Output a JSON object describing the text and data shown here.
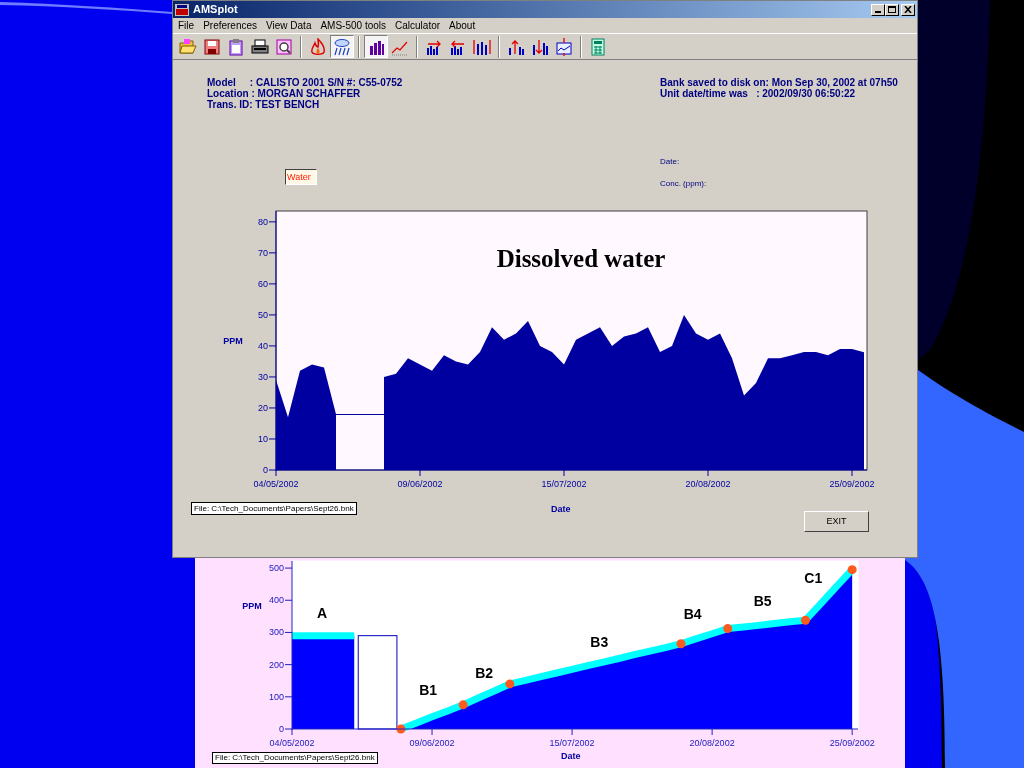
{
  "window": {
    "title": "AMSplot"
  },
  "menu": [
    "File",
    "Preferences",
    "View Data",
    "AMS-500 tools",
    "Calculator",
    "About"
  ],
  "toolbar": [
    [
      {
        "kind": "folder",
        "selected": false
      },
      {
        "kind": "floppy",
        "selected": false
      },
      {
        "kind": "clipboard",
        "selected": false
      },
      {
        "kind": "printer",
        "selected": false
      },
      {
        "kind": "preview",
        "selected": false
      }
    ],
    [
      {
        "kind": "flame",
        "selected": false
      },
      {
        "kind": "rain",
        "selected": true
      }
    ],
    [
      {
        "kind": "bars",
        "selected": true
      },
      {
        "kind": "line",
        "selected": false
      }
    ],
    [
      {
        "kind": "bars-right",
        "selected": false
      },
      {
        "kind": "bars-left",
        "selected": false
      },
      {
        "kind": "bars-expand",
        "selected": false
      }
    ],
    [
      {
        "kind": "bars-up",
        "selected": false
      },
      {
        "kind": "bars-down",
        "selected": false
      },
      {
        "kind": "bars-zoom",
        "selected": false
      }
    ],
    [
      {
        "kind": "calculator",
        "selected": false
      }
    ]
  ],
  "info": {
    "lines": [
      "Model     : CALISTO 2001 S/N #: C55-0752",
      "Location : MORGAN SCHAFFER",
      "Trans. ID: TEST BENCH"
    ],
    "saved": [
      "Bank saved to disk on: Mon Sep 30, 2002 at 07h50",
      "Unit date/time was   : 2002/09/30 06:50:22"
    ]
  },
  "gas_field": {
    "value": "Water"
  },
  "cursor_readout": [
    "Date:",
    "Conc. (ppm):"
  ],
  "chart": {
    "chart_data": {
      "type": "area",
      "title": "Dissolved water",
      "xlabel": "Date",
      "ylabel": "PPM",
      "categories": [
        "04/05/2002",
        null,
        null,
        null,
        null,
        null,
        null,
        null,
        null,
        null,
        null,
        null,
        "09/06/2002",
        null,
        null,
        null,
        null,
        null,
        null,
        null,
        null,
        null,
        null,
        null,
        "15/07/2002",
        null,
        null,
        null,
        null,
        null,
        null,
        null,
        null,
        null,
        null,
        null,
        "20/08/2002",
        null,
        null,
        null,
        null,
        null,
        null,
        null,
        null,
        null,
        null,
        null,
        "25/09/2002",
        null
      ],
      "series": [
        {
          "color": "#0000a0",
          "values": [
            29,
            17,
            32,
            34,
            33,
            18,
            null,
            null,
            null,
            30,
            31,
            36,
            34,
            32,
            37,
            35,
            34,
            38,
            46,
            42,
            44,
            48,
            40,
            38,
            34,
            42,
            44,
            46,
            40,
            43,
            44,
            46,
            38,
            40,
            50,
            44,
            42,
            44,
            36,
            24,
            28,
            36,
            36,
            37,
            38,
            38,
            37,
            39,
            39,
            38
          ]
        }
      ],
      "ylim": [
        0,
        83.5
      ],
      "yticks": [
        0,
        10,
        20,
        30,
        40,
        50,
        60,
        70,
        80
      ]
    },
    "file_path": "File: C:\\Tech_Documents\\Papers\\Sept26.bnk"
  },
  "exit_button": "EXIT",
  "overview": {
    "chart_data": {
      "type": "area",
      "xlabel": "Date",
      "ylabel": "PPM",
      "categories": [
        "04/05/2002",
        null,
        null,
        null,
        null,
        null,
        null,
        null,
        null,
        "09/06/2002",
        null,
        null,
        null,
        null,
        null,
        null,
        null,
        null,
        "15/07/2002",
        null,
        null,
        null,
        null,
        null,
        null,
        null,
        null,
        "20/08/2002",
        null,
        null,
        null,
        null,
        null,
        null,
        null,
        null,
        "25/09/2002"
      ],
      "series": [
        {
          "color": "#00ffff",
          "values": [
            290,
            290,
            290,
            290,
            290,
            null,
            null,
            0,
            19,
            38,
            56,
            75,
            97,
            118,
            140,
            151,
            163,
            174,
            185,
            197,
            208,
            219,
            231,
            242,
            253,
            265,
            281,
            296,
            312,
            317,
            322,
            328,
            333,
            338,
            390,
            443,
            495
          ]
        }
      ],
      "ylim": [
        0,
        522
      ],
      "yticks": [
        0,
        100,
        200,
        300,
        400,
        500
      ],
      "annotations": [
        "A",
        "B1",
        "B2",
        "B3",
        "B4",
        "B5",
        "C1"
      ]
    },
    "file_path": "File: C:\\Tech_Documents\\Papers\\Sept26.bnk"
  }
}
